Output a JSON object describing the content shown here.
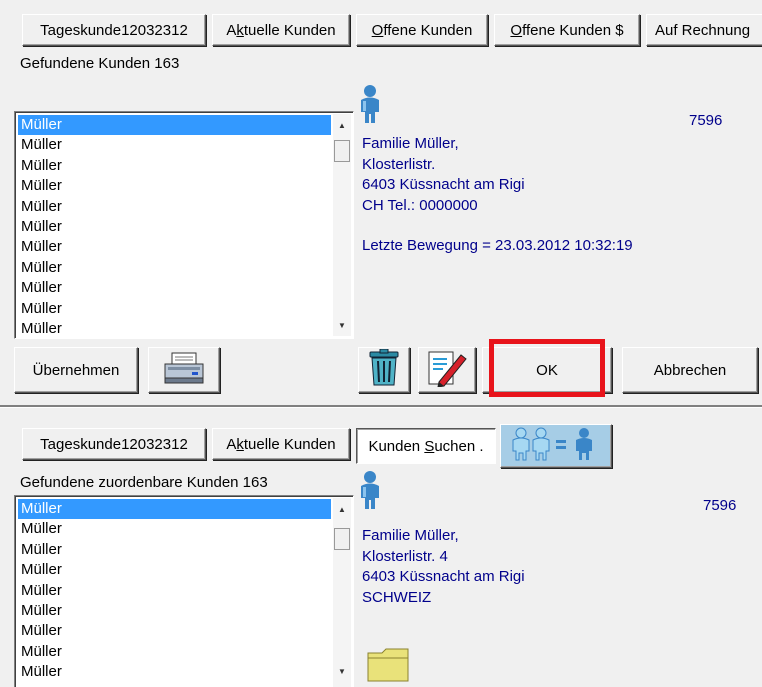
{
  "top": {
    "tabs": [
      {
        "label": "Tageskunde12032312"
      },
      {
        "pre": "A",
        "u": "k",
        "post": "tuelle Kunden"
      },
      {
        "pre": "",
        "u": "O",
        "post": "ffene Kunden"
      },
      {
        "pre": "",
        "u": "O",
        "post": "ffene Kunden $"
      },
      {
        "label": "Auf Rechnung"
      }
    ],
    "found_label": "Gefundene Kunden 163",
    "list": [
      "Müller",
      "Müller",
      "Müller",
      "Müller",
      "Müller",
      "Müller",
      "Müller",
      "Müller",
      "Müller",
      "Müller",
      "Müller"
    ],
    "customer_number": "7596",
    "address": [
      "Familie Müller,",
      "Klosterlistr.",
      "6403 Küssnacht am Rigi",
      "CH Tel.: 0000000"
    ],
    "last_movement": "Letzte Bewegung = 23.03.2012 10:32:19",
    "buttons": {
      "take_over": "Übernehmen",
      "ok": "OK",
      "cancel": "Abbrechen"
    }
  },
  "bottom": {
    "tabs": [
      {
        "label": "Tageskunde12032312"
      },
      {
        "pre": "A",
        "u": "k",
        "post": "tuelle Kunden"
      },
      {
        "pre": "Kunden ",
        "u": "S",
        "post": "uchen ."
      }
    ],
    "found_label": "Gefundene zuordenbare Kunden 163",
    "list": [
      "Müller",
      "Müller",
      "Müller",
      "Müller",
      "Müller",
      "Müller",
      "Müller",
      "Müller",
      "Müller"
    ],
    "customer_number": "7596",
    "address": [
      "Familie Müller,",
      "Klosterlistr. 4",
      "6403 Küssnacht am Rigi",
      "SCHWEIZ"
    ]
  },
  "colors": {
    "highlight": "#e8141b",
    "selection": "#3399ff",
    "info_text": "#00008b"
  },
  "icons": [
    "person-icon",
    "printer-icon",
    "trash-icon",
    "edit-pencil-icon",
    "merge-customers-icon",
    "folder-icon"
  ]
}
